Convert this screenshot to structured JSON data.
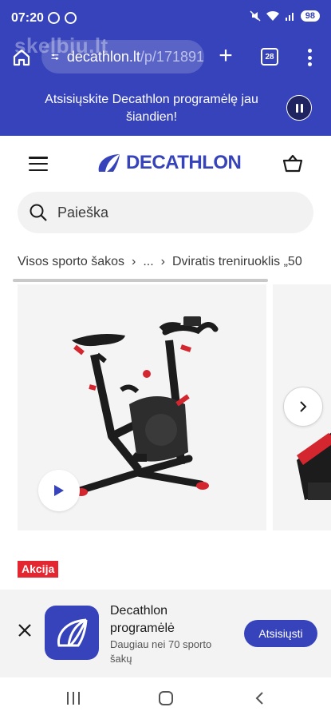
{
  "status": {
    "time": "07:20",
    "battery": "98",
    "icons": [
      "threads-icon",
      "record-icon",
      "mute-icon",
      "wifi-icon",
      "signal-icon"
    ]
  },
  "browser": {
    "watermark": "skelbiu.lt",
    "url_domain": "decathlon.lt",
    "url_path": "/p/171891",
    "tab_count": "28"
  },
  "promo": {
    "text": "Atsisiųskite Decathlon programėlę jau šiandien!"
  },
  "header": {
    "logo_text": "DECATHLON",
    "brand_color": "#3643ba"
  },
  "search": {
    "placeholder": "Paieška"
  },
  "breadcrumb": {
    "items": [
      "Visos sporto šakos",
      "...",
      "Dviratis treniruoklis „50"
    ]
  },
  "product": {
    "badge": "Akcija",
    "badge_color": "#e3262f"
  },
  "app_banner": {
    "name": "Decathlon programėlė",
    "description": "Daugiau nei 70 sporto šakų",
    "button": "Atsisiųsti"
  }
}
